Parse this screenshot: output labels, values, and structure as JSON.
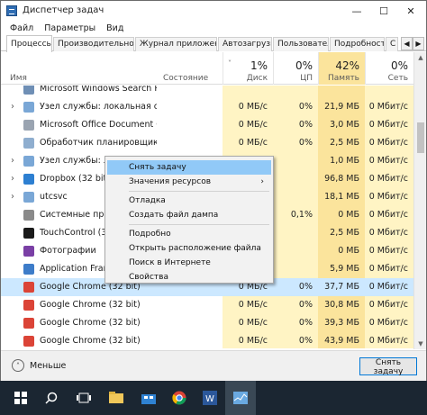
{
  "window": {
    "title": "Диспетчер задач",
    "minimize": "—",
    "maximize": "☐",
    "close": "✕"
  },
  "menu": [
    "Файл",
    "Параметры",
    "Вид"
  ],
  "tabs": [
    "Процессы",
    "Производительность",
    "Журнал приложений",
    "Автозагрузка",
    "Пользователи",
    "Подробности",
    "С"
  ],
  "header": {
    "name": "Имя",
    "state": "Состояние",
    "disk_pct": "1%",
    "disk": "Диск",
    "cpu_pct": "0%",
    "cpu": "ЦП",
    "mem_pct": "42%",
    "mem": "Память",
    "net_pct": "0%",
    "net": "Сеть"
  },
  "rows": [
    {
      "name": "Microsoft Windows Search Pro...",
      "disk": "",
      "cpu": "",
      "mem": "",
      "net": "",
      "icon": "search-service-icon",
      "expand": false,
      "color": "#6f8fb5"
    },
    {
      "name": "Узел службы: локальная систе...",
      "disk": "0 МБ/с",
      "cpu": "0%",
      "mem": "21,9 МБ",
      "net": "0 Мбит/с",
      "icon": "gear-service-icon",
      "expand": true,
      "color": "#7aa7d6"
    },
    {
      "name": "Microsoft Office Document Cac...",
      "disk": "0 МБ/с",
      "cpu": "0%",
      "mem": "3,0 МБ",
      "net": "0 Мбит/с",
      "icon": "office-icon",
      "expand": false,
      "color": "#9aa4b1"
    },
    {
      "name": "Обработчик планировщика зад...",
      "disk": "0 МБ/с",
      "cpu": "0%",
      "mem": "2,5 МБ",
      "net": "0 Мбит/с",
      "icon": "scheduler-icon",
      "expand": false,
      "color": "#8faecf"
    },
    {
      "name": "Узел службы: лока",
      "disk": "",
      "cpu": "",
      "mem": "1,0 МБ",
      "net": "0 Мбит/с",
      "icon": "gear-service-icon",
      "expand": true,
      "color": "#7aa7d6"
    },
    {
      "name": "Dropbox (32 bit)",
      "disk": "",
      "cpu": "",
      "mem": "96,8 МБ",
      "net": "0 Мбит/с",
      "icon": "dropbox-icon",
      "expand": true,
      "color": "#2d7fd1"
    },
    {
      "name": "utcsvc",
      "disk": "",
      "cpu": "",
      "mem": "18,1 МБ",
      "net": "0 Мбит/с",
      "icon": "gear-service-icon",
      "expand": true,
      "color": "#7aa7d6"
    },
    {
      "name": "Системные преры",
      "disk": "",
      "cpu": "0,1%",
      "mem": "0 МБ",
      "net": "0 Мбит/с",
      "icon": "system-icon",
      "expand": false,
      "color": "#8a8a8a"
    },
    {
      "name": "TouchControl (32 b",
      "disk": "",
      "cpu": "",
      "mem": "2,5 МБ",
      "net": "0 Мбит/с",
      "icon": "touchcontrol-icon",
      "expand": false,
      "color": "#1a1a1a"
    },
    {
      "name": "Фотографии",
      "disk": "",
      "cpu": "",
      "mem": "0 МБ",
      "net": "0 Мбит/с",
      "icon": "photos-icon",
      "expand": false,
      "color": "#7a3fa5"
    },
    {
      "name": "Application Frame I",
      "disk": "",
      "cpu": "",
      "mem": "5,9 МБ",
      "net": "0 Мбит/с",
      "icon": "app-frame-icon",
      "expand": false,
      "color": "#3d7cc9"
    },
    {
      "name": "Google Chrome (32 bit)",
      "disk": "0 МБ/с",
      "cpu": "0%",
      "mem": "37,7 МБ",
      "net": "0 Мбит/с",
      "icon": "chrome-icon",
      "expand": false,
      "color": "#db4437",
      "selected": true
    },
    {
      "name": "Google Chrome (32 bit)",
      "disk": "0 МБ/с",
      "cpu": "0%",
      "mem": "30,8 МБ",
      "net": "0 Мбит/с",
      "icon": "chrome-icon",
      "expand": false,
      "color": "#db4437"
    },
    {
      "name": "Google Chrome (32 bit)",
      "disk": "0 МБ/с",
      "cpu": "0%",
      "mem": "39,3 МБ",
      "net": "0 Мбит/с",
      "icon": "chrome-icon",
      "expand": false,
      "color": "#db4437"
    },
    {
      "name": "Google Chrome (32 bit)",
      "disk": "0 МБ/с",
      "cpu": "0%",
      "mem": "43,9 МБ",
      "net": "0 Мбит/с",
      "icon": "chrome-icon",
      "expand": false,
      "color": "#db4437"
    }
  ],
  "context_menu": [
    {
      "label": "Снять задачу",
      "highlight": true
    },
    {
      "label": "Значения ресурсов",
      "submenu": true
    },
    {
      "sep": true
    },
    {
      "label": "Отладка"
    },
    {
      "label": "Создать файл дампа"
    },
    {
      "sep": true
    },
    {
      "label": "Подробно"
    },
    {
      "label": "Открыть расположение файла"
    },
    {
      "label": "Поиск в Интернете"
    },
    {
      "label": "Свойства"
    }
  ],
  "footer": {
    "less_label": "Меньше",
    "less_icon": "˄",
    "end_task": "Снять задачу"
  },
  "taskbar": [
    "start-icon",
    "search-icon",
    "task-view-icon",
    "file-explorer-icon",
    "store-icon",
    "chrome-icon",
    "word-icon",
    "task-manager-icon"
  ],
  "colors": {
    "selection": "#cce8ff",
    "heat_light": "#fff4c4",
    "heat_mem": "#fbe49c",
    "accent": "#0078d7",
    "taskbar": "#1b2632"
  }
}
